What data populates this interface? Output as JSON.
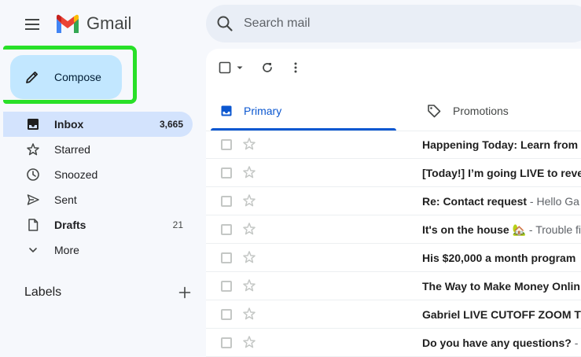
{
  "app": {
    "name": "Gmail"
  },
  "search": {
    "placeholder": "Search mail"
  },
  "compose": {
    "label": "Compose"
  },
  "nav": {
    "items": [
      {
        "id": "inbox",
        "label": "Inbox",
        "count": "3,665",
        "icon": "inbox-icon"
      },
      {
        "id": "starred",
        "label": "Starred",
        "count": "",
        "icon": "star-icon"
      },
      {
        "id": "snoozed",
        "label": "Snoozed",
        "count": "",
        "icon": "clock-icon"
      },
      {
        "id": "sent",
        "label": "Sent",
        "count": "",
        "icon": "send-icon"
      },
      {
        "id": "drafts",
        "label": "Drafts",
        "count": "21",
        "icon": "draft-icon"
      },
      {
        "id": "more",
        "label": "More",
        "count": "",
        "icon": "chevron-down-icon"
      }
    ]
  },
  "labels": {
    "title": "Labels"
  },
  "tabs": [
    {
      "id": "primary",
      "label": "Primary",
      "icon": "inbox-icon"
    },
    {
      "id": "promotions",
      "label": "Promotions",
      "icon": "tag-icon"
    }
  ],
  "emails": [
    {
      "sender": "",
      "subject": "Happening Today: Learn from",
      "snippet": ""
    },
    {
      "sender": "",
      "subject": "[Today!] I’m going LIVE to reve",
      "snippet": ""
    },
    {
      "sender": "",
      "subject": "Re: Contact request",
      "snippet": " - Hello Ga"
    },
    {
      "sender": "",
      "subject": "It's on the house 🏡",
      "snippet": " - Trouble fi"
    },
    {
      "sender": "",
      "subject": "His $20,000 a month program",
      "snippet": ""
    },
    {
      "sender": "",
      "subject": "The Way to Make Money Onlin",
      "snippet": ""
    },
    {
      "sender": "",
      "subject": "Gabriel LIVE CUTOFF ZOOM T",
      "snippet": ""
    },
    {
      "sender": "",
      "subject": "Do you have any questions?",
      "snippet": " - "
    }
  ],
  "colors": {
    "accent": "#0b57d0",
    "compose_bg": "#c2e7ff",
    "highlight": "#28e028",
    "active_nav": "#d3e3fd"
  }
}
